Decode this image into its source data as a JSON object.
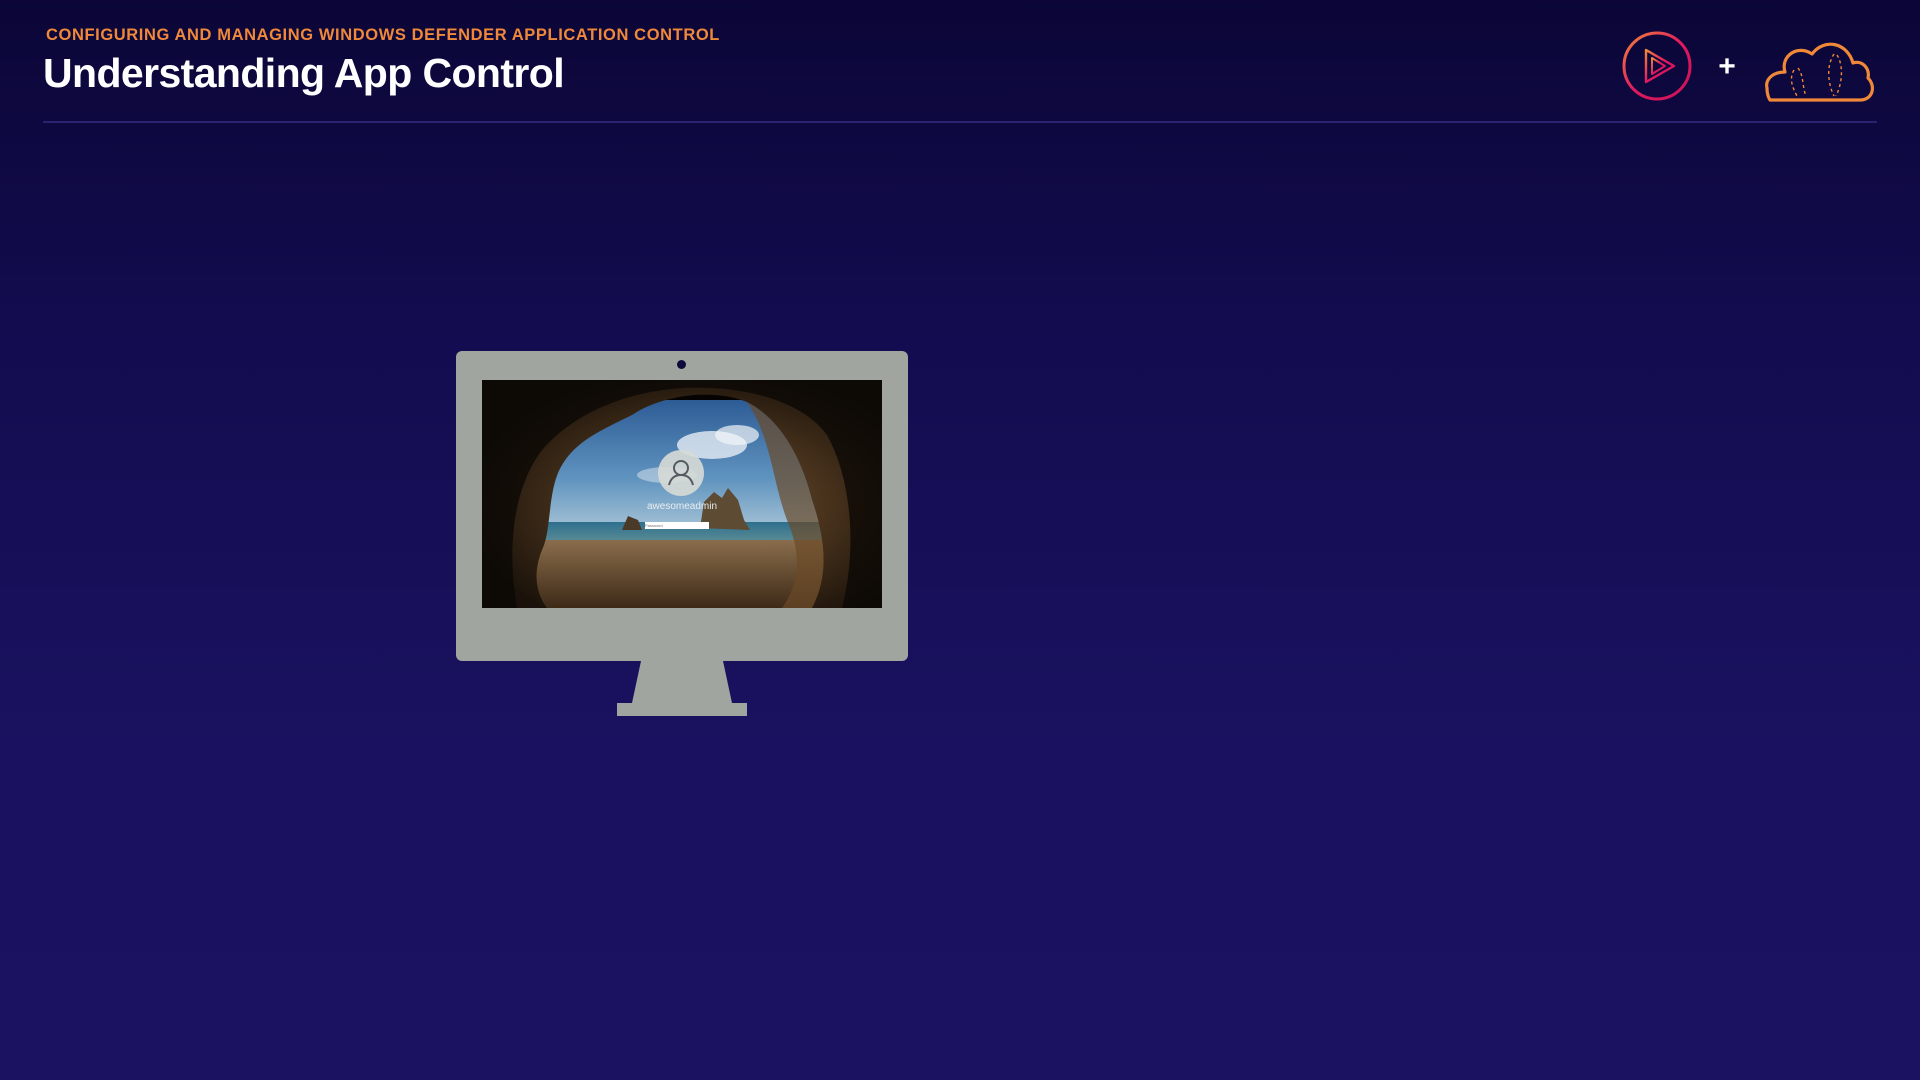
{
  "header": {
    "eyebrow": "CONFIGURING AND MANAGING WINDOWS DEFENDER APPLICATION CONTROL",
    "title": "Understanding App Control",
    "plus": "+"
  },
  "logos": {
    "left_icon": "play-circle-icon",
    "right_icon": "cloud-icon"
  },
  "screen": {
    "username": "awesomeadmin",
    "password_placeholder": "Password"
  },
  "colors": {
    "eyebrow": "#f0883a",
    "cloud": "#f0883a",
    "play_gradient_start": "#f0883a",
    "play_gradient_end": "#e1195f",
    "monitor": "#a0a59f"
  }
}
